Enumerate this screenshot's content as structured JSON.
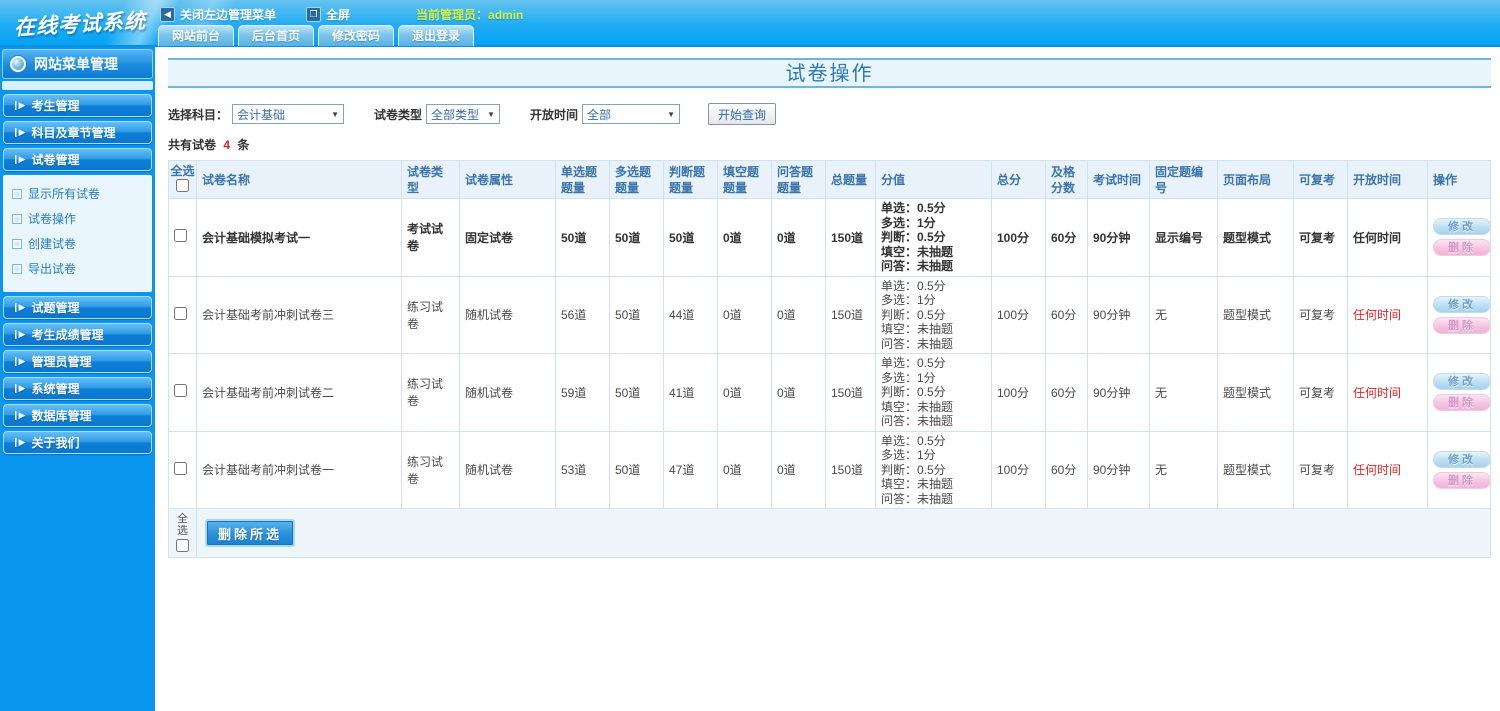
{
  "header": {
    "logo": "在线考试系统",
    "menu": {
      "close_label": "关闭左边管理菜单",
      "fullscreen_label": "全屏",
      "admin_label": "当前管理员：admin"
    },
    "tabs": [
      "网站前台",
      "后台首页",
      "修改密码",
      "退出登录"
    ]
  },
  "sidebar": {
    "title": "网站菜单管理",
    "menu_top": [
      "考生管理",
      "科目及章节管理",
      "试卷管理"
    ],
    "submenu": [
      "显示所有试卷",
      "试卷操作",
      "创建试卷",
      "导出试卷"
    ],
    "menu_bottom": [
      "试题管理",
      "考生成绩管理",
      "管理员管理",
      "系统管理",
      "数据库管理",
      "关于我们"
    ]
  },
  "page": {
    "title": "试卷操作",
    "filters": {
      "subject_label": "选择科目：",
      "subject_value": "会计基础",
      "type_label": "试卷类型",
      "type_value": "全部类型",
      "time_label": "开放时间",
      "time_value": "全部",
      "search_label": "开始查询"
    },
    "count": {
      "prefix": "共有试卷",
      "value": "4",
      "suffix": "条"
    }
  },
  "table": {
    "headers": [
      "全选",
      "试卷名称",
      "试卷类型",
      "试卷属性",
      "单选题题量",
      "多选题题量",
      "判断题题量",
      "填空题题量",
      "问答题题量",
      "总题量",
      "分值",
      "总分",
      "及格分数",
      "考试时间",
      "固定题编号",
      "页面布局",
      "可复考",
      "开放时间",
      "操作"
    ],
    "edit_label": "修改",
    "delete_label": "删除",
    "rows": [
      {
        "name": "会计基础模拟考试一",
        "type": "考试试卷",
        "attr": "固定试卷",
        "counts": [
          "50道",
          "50道",
          "50道",
          "0道",
          "0道",
          "150道"
        ],
        "score": [
          "单选：0.5分",
          "多选：1分",
          "判断：0.5分",
          "填空：未抽题",
          "问答：未抽题"
        ],
        "total": "100分",
        "pass": "60分",
        "time": "90分钟",
        "fixed": "显示编号",
        "layout": "题型模式",
        "retake": "可复考",
        "open": "任何时间"
      },
      {
        "name": "会计基础考前冲刺试卷三",
        "type": "练习试卷",
        "attr": "随机试卷",
        "counts": [
          "56道",
          "50道",
          "44道",
          "0道",
          "0道",
          "150道"
        ],
        "score": [
          "单选：0.5分",
          "多选：1分",
          "判断：0.5分",
          "填空：未抽题",
          "问答：未抽题"
        ],
        "total": "100分",
        "pass": "60分",
        "time": "90分钟",
        "fixed": "无",
        "layout": "题型模式",
        "retake": "可复考",
        "open": "任何时间"
      },
      {
        "name": "会计基础考前冲刺试卷二",
        "type": "练习试卷",
        "attr": "随机试卷",
        "counts": [
          "59道",
          "50道",
          "41道",
          "0道",
          "0道",
          "150道"
        ],
        "score": [
          "单选：0.5分",
          "多选：1分",
          "判断：0.5分",
          "填空：未抽题",
          "问答：未抽题"
        ],
        "total": "100分",
        "pass": "60分",
        "time": "90分钟",
        "fixed": "无",
        "layout": "题型模式",
        "retake": "可复考",
        "open": "任何时间"
      },
      {
        "name": "会计基础考前冲刺试卷一",
        "type": "练习试卷",
        "attr": "随机试卷",
        "counts": [
          "53道",
          "50道",
          "47道",
          "0道",
          "0道",
          "150道"
        ],
        "score": [
          "单选：0.5分",
          "多选：1分",
          "判断：0.5分",
          "填空：未抽题",
          "问答：未抽题"
        ],
        "total": "100分",
        "pass": "60分",
        "time": "90分钟",
        "fixed": "无",
        "layout": "题型模式",
        "retake": "可复考",
        "open": "任何时间"
      }
    ],
    "footer": {
      "select_all_label": "全选",
      "delete_selected_label": "删除所选"
    }
  }
}
